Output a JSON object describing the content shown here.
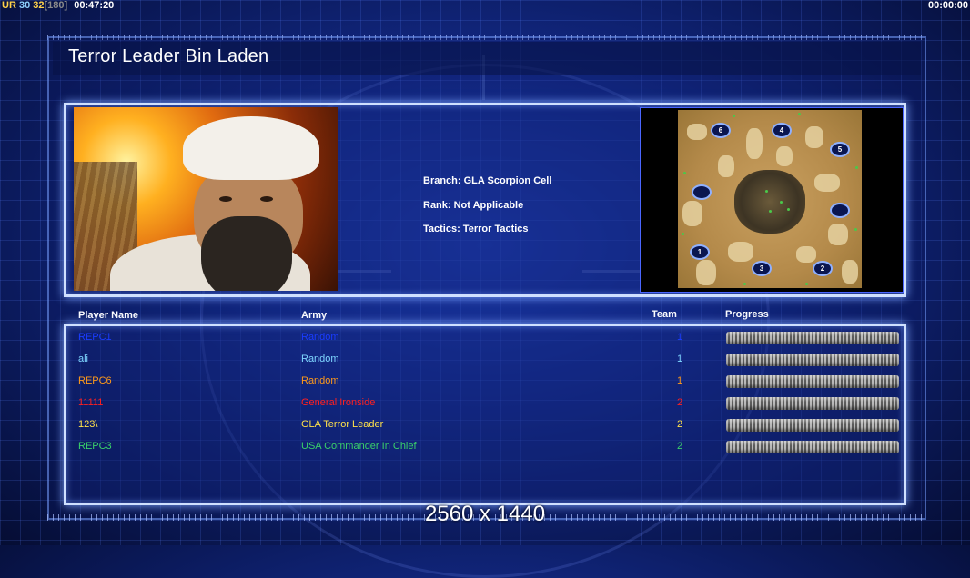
{
  "hud": {
    "ur_label": "UR",
    "fps": "30",
    "fps_target": "32",
    "fps_cap": "[180]",
    "elapsed_time": "00:47:20",
    "countdown": "00:00:00"
  },
  "screen": {
    "title": "Terror Leader Bin Laden",
    "resolution_label": "2560 x 1440"
  },
  "general": {
    "branch": "Branch: GLA Scorpion Cell",
    "rank": "Rank: Not Applicable",
    "tactics": "Tactics: Terror Tactics"
  },
  "map": {
    "spawns": [
      "1",
      "2",
      "3",
      "4",
      "5",
      "6",
      "",
      ""
    ]
  },
  "players_table": {
    "columns": {
      "name": "Player Name",
      "army": "Army",
      "team": "Team",
      "progress": "Progress"
    },
    "rows": [
      {
        "name": "REPC1",
        "army": "Random",
        "team": "1",
        "color": "#1a3cff"
      },
      {
        "name": "ali",
        "army": "Random",
        "team": "1",
        "color": "#7fd6ff"
      },
      {
        "name": "REPC6",
        "army": "Random",
        "team": "1",
        "color": "#ff9a1a"
      },
      {
        "name": "11111",
        "army": "General Ironside",
        "team": "2",
        "color": "#ff2020"
      },
      {
        "name": "123\\",
        "army": "GLA Terror Leader",
        "team": "2",
        "color": "#ffe14a"
      },
      {
        "name": "REPC3",
        "army": "USA Commander In Chief",
        "team": "2",
        "color": "#3ad06a"
      }
    ]
  }
}
